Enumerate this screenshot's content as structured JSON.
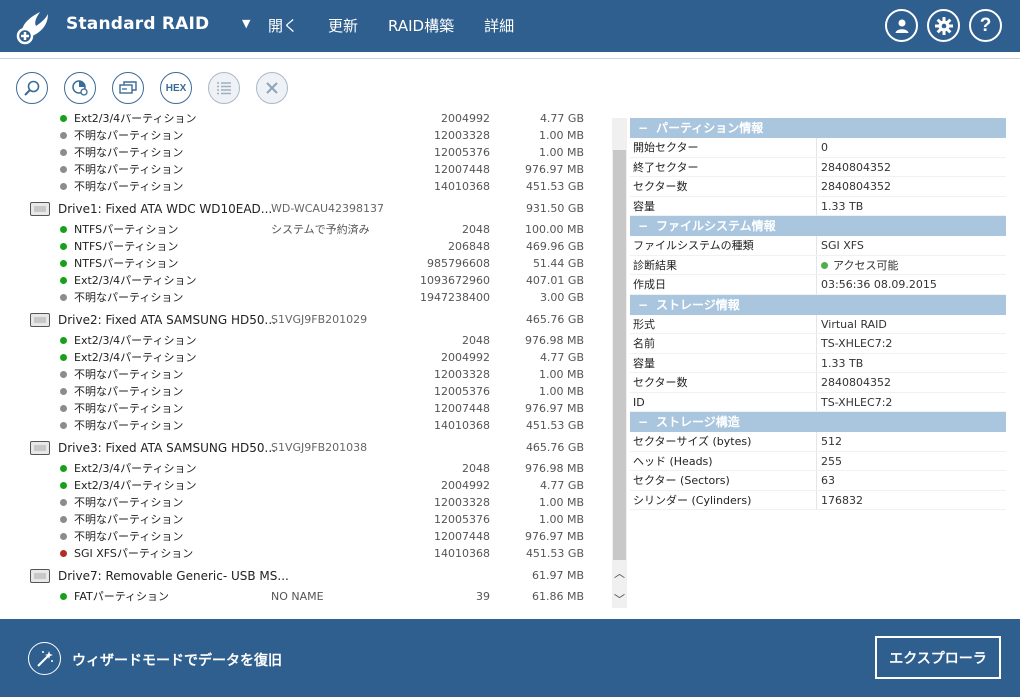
{
  "app": {
    "title": "Standard RAID"
  },
  "menu": {
    "items": [
      "開く",
      "更新",
      "RAID構築",
      "詳細"
    ]
  },
  "toolbar": {
    "icons": [
      "search-icon",
      "partition-scan-icon",
      "drive-image-icon",
      "hex-icon",
      "list-icon",
      "close-icon"
    ],
    "hex_label": "HEX"
  },
  "tree": {
    "top_partial": [
      {
        "name": "Ext2/3/4パーティション",
        "start": "2004992",
        "size": "4.77 GB",
        "status": "green"
      },
      {
        "name": "不明なパーティション",
        "start": "12003328",
        "size": "1.00 MB",
        "status": "gray"
      },
      {
        "name": "不明なパーティション",
        "start": "12005376",
        "size": "1.00 MB",
        "status": "gray"
      },
      {
        "name": "不明なパーティション",
        "start": "12007448",
        "size": "976.97 MB",
        "status": "gray"
      },
      {
        "name": "不明なパーティション",
        "start": "14010368",
        "size": "451.53 GB",
        "status": "gray"
      }
    ],
    "drives": [
      {
        "name": "Drive1: Fixed ATA WDC WD10EAD...",
        "serial": "WD-WCAU42398137",
        "size": "931.50 GB",
        "partitions": [
          {
            "name": "NTFSパーティション",
            "label": "システムで予約済み",
            "start": "2048",
            "size": "100.00 MB",
            "status": "green"
          },
          {
            "name": "NTFSパーティション",
            "label": "",
            "start": "206848",
            "size": "469.96 GB",
            "status": "green"
          },
          {
            "name": "NTFSパーティション",
            "label": "",
            "start": "985796608",
            "size": "51.44 GB",
            "status": "green"
          },
          {
            "name": "Ext2/3/4パーティション",
            "label": "",
            "start": "1093672960",
            "size": "407.01 GB",
            "status": "green"
          },
          {
            "name": "不明なパーティション",
            "label": "",
            "start": "1947238400",
            "size": "3.00 GB",
            "status": "gray"
          }
        ]
      },
      {
        "name": "Drive2: Fixed ATA SAMSUNG HD50...",
        "serial": "S1VGJ9FB201029",
        "size": "465.76 GB",
        "partitions": [
          {
            "name": "Ext2/3/4パーティション",
            "label": "",
            "start": "2048",
            "size": "976.98 MB",
            "status": "green"
          },
          {
            "name": "Ext2/3/4パーティション",
            "label": "",
            "start": "2004992",
            "size": "4.77 GB",
            "status": "green"
          },
          {
            "name": "不明なパーティション",
            "label": "",
            "start": "12003328",
            "size": "1.00 MB",
            "status": "gray"
          },
          {
            "name": "不明なパーティション",
            "label": "",
            "start": "12005376",
            "size": "1.00 MB",
            "status": "gray"
          },
          {
            "name": "不明なパーティション",
            "label": "",
            "start": "12007448",
            "size": "976.97 MB",
            "status": "gray"
          },
          {
            "name": "不明なパーティション",
            "label": "",
            "start": "14010368",
            "size": "451.53 GB",
            "status": "gray"
          }
        ]
      },
      {
        "name": "Drive3: Fixed ATA SAMSUNG HD50...",
        "serial": "S1VGJ9FB201038",
        "size": "465.76 GB",
        "partitions": [
          {
            "name": "Ext2/3/4パーティション",
            "label": "",
            "start": "2048",
            "size": "976.98 MB",
            "status": "green"
          },
          {
            "name": "Ext2/3/4パーティション",
            "label": "",
            "start": "2004992",
            "size": "4.77 GB",
            "status": "green"
          },
          {
            "name": "不明なパーティション",
            "label": "",
            "start": "12003328",
            "size": "1.00 MB",
            "status": "gray"
          },
          {
            "name": "不明なパーティション",
            "label": "",
            "start": "12005376",
            "size": "1.00 MB",
            "status": "gray"
          },
          {
            "name": "不明なパーティション",
            "label": "",
            "start": "12007448",
            "size": "976.97 MB",
            "status": "gray"
          },
          {
            "name": "SGI XFSパーティション",
            "label": "",
            "start": "14010368",
            "size": "451.53 GB",
            "status": "red"
          }
        ]
      },
      {
        "name": "Drive7: Removable Generic- USB MS...",
        "serial": "",
        "size": "61.97 MB",
        "partitions": [
          {
            "name": "FATパーティション",
            "label": "NO NAME",
            "start": "39",
            "size": "61.86 MB",
            "status": "green"
          }
        ]
      }
    ]
  },
  "properties": {
    "sections": [
      {
        "title": "パーティション情報",
        "rows": [
          {
            "key": "開始セクター",
            "value": "0"
          },
          {
            "key": "終了セクター",
            "value": "2840804352"
          },
          {
            "key": "セクター数",
            "value": "2840804352"
          },
          {
            "key": "容量",
            "value": "1.33 TB"
          }
        ]
      },
      {
        "title": "ファイルシステム情報",
        "rows": [
          {
            "key": "ファイルシステムの種類",
            "value": "SGI XFS"
          },
          {
            "key": "診断結果",
            "value": "アクセス可能",
            "status": true
          },
          {
            "key": "作成日",
            "value": "03:56:36 08.09.2015"
          }
        ]
      },
      {
        "title": "ストレージ情報",
        "rows": [
          {
            "key": "形式",
            "value": "Virtual RAID"
          },
          {
            "key": "名前",
            "value": "TS-XHLEC7:2"
          },
          {
            "key": "容量",
            "value": "1.33 TB"
          },
          {
            "key": "セクター数",
            "value": "2840804352"
          },
          {
            "key": "ID",
            "value": "TS-XHLEC7:2"
          }
        ]
      },
      {
        "title": "ストレージ構造",
        "rows": [
          {
            "key": "セクターサイズ (bytes)",
            "value": "512"
          },
          {
            "key": "ヘッド (Heads)",
            "value": "255"
          },
          {
            "key": "セクター (Sectors)",
            "value": "63"
          },
          {
            "key": "シリンダー (Cylinders)",
            "value": "176832"
          }
        ]
      }
    ]
  },
  "footer": {
    "wizard_label": "ウィザードモードでデータを復旧",
    "explorer_label": "エクスプローラ"
  },
  "colors": {
    "header_bg": "#2f5f8e",
    "section_bg": "#a9c6de",
    "ok": "#19a01a",
    "unknown": "#8c8c8c",
    "error": "#b52a2a"
  }
}
